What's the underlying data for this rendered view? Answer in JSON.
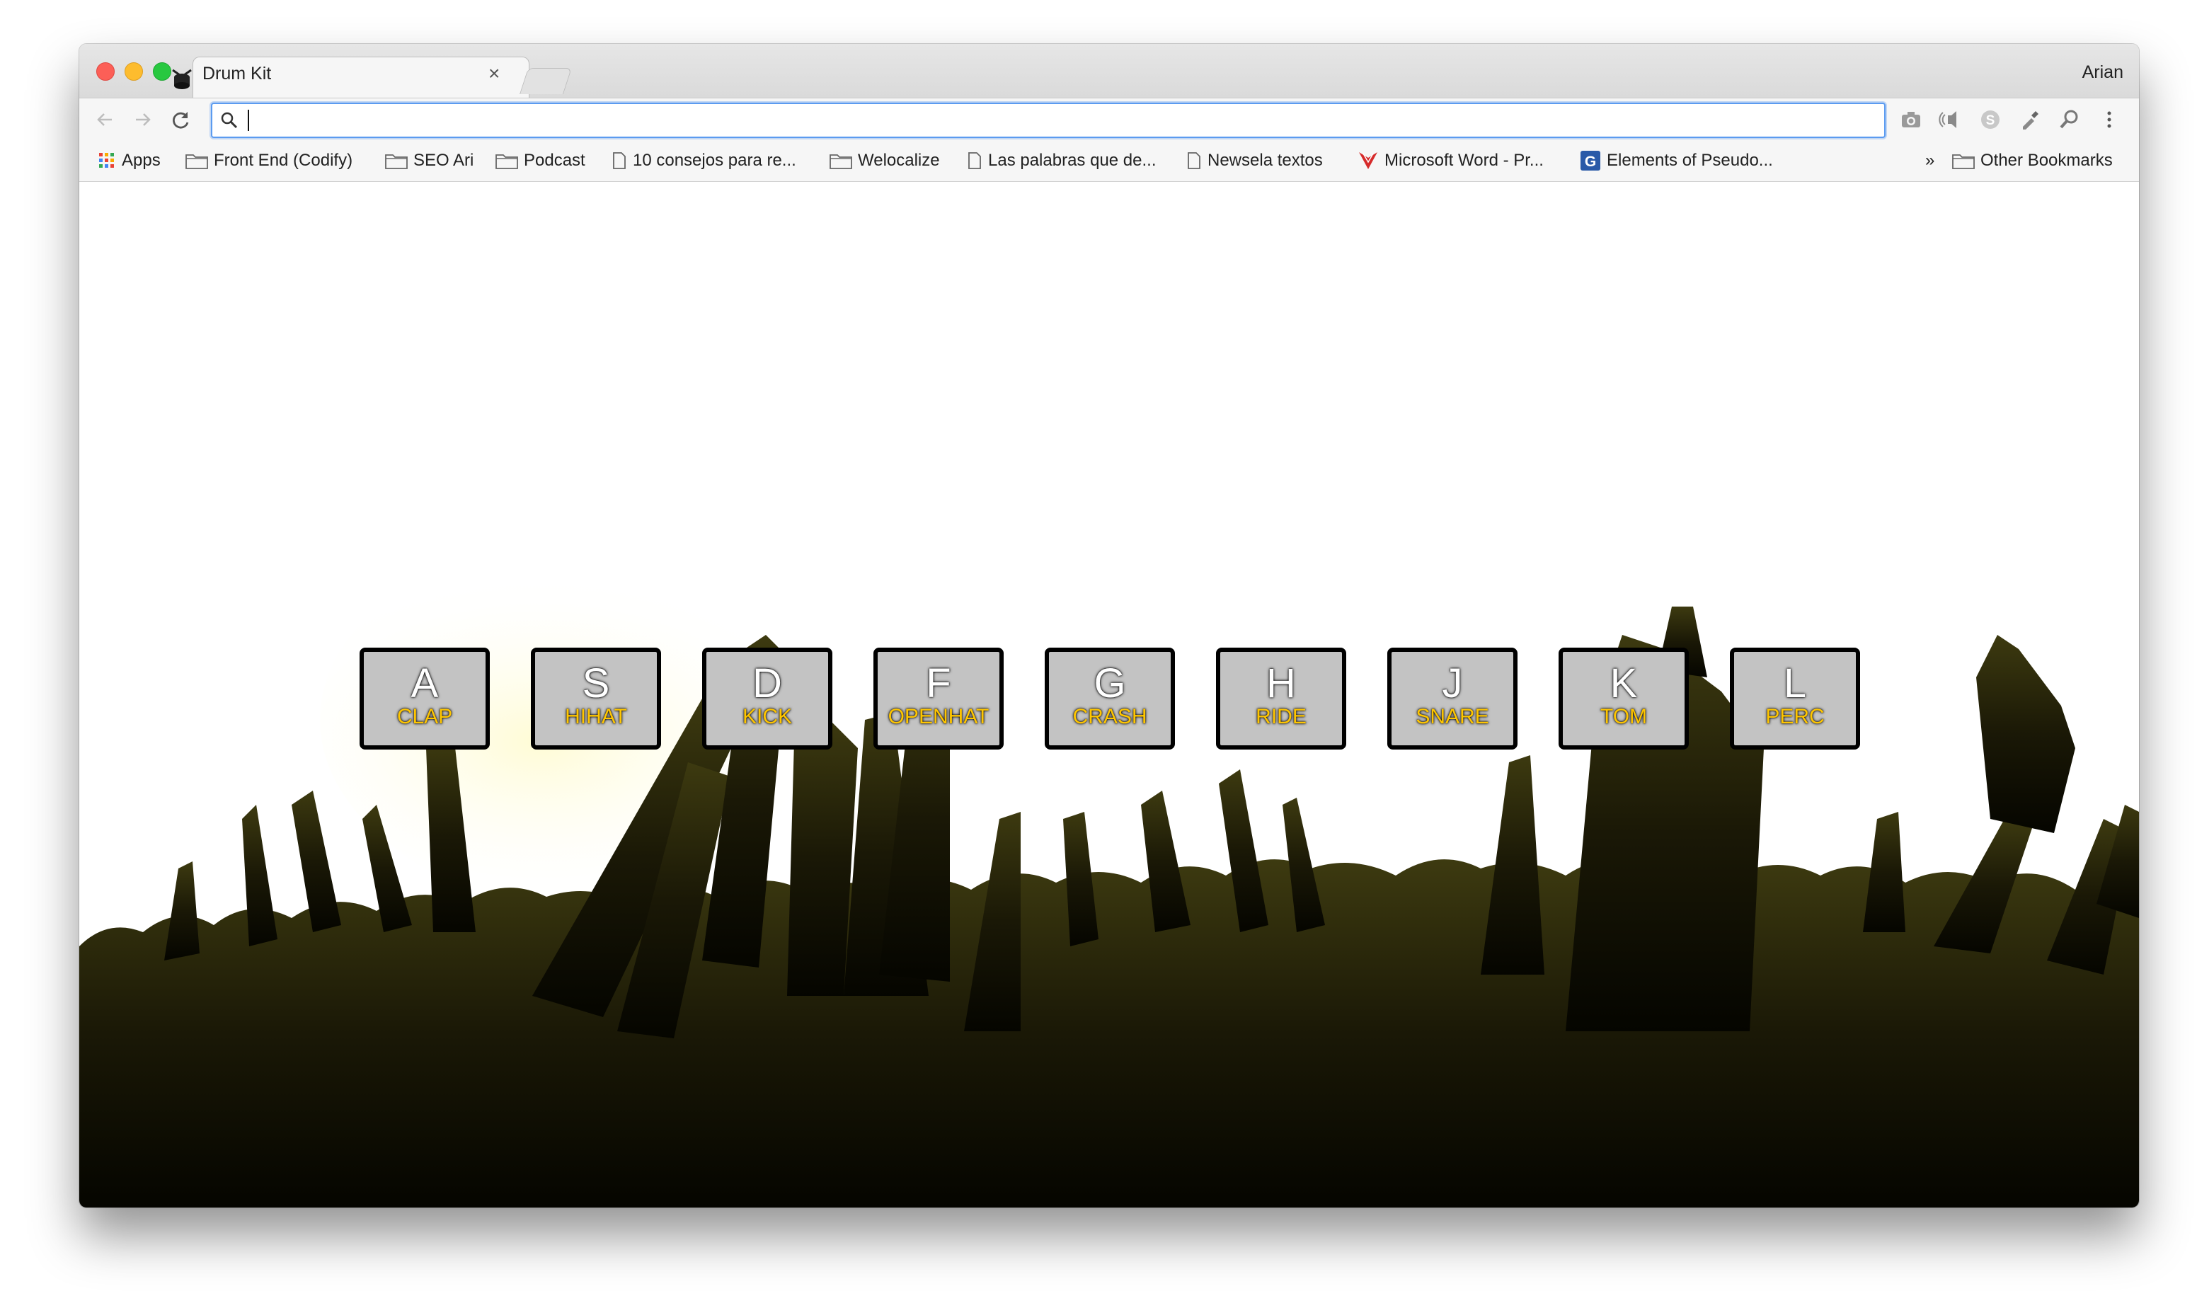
{
  "browser": {
    "tab_title": "Drum Kit",
    "profile_name": "Arian",
    "address_value": "",
    "icons": {
      "tab": "drum-icon",
      "back": "back-arrow-icon",
      "forward": "forward-arrow-icon",
      "reload": "reload-icon",
      "search": "search-icon",
      "extensions": [
        "camera-icon",
        "audio-icon",
        "skype-icon",
        "eyedropper-icon",
        "zoom-icon",
        "more-vertical-icon"
      ]
    }
  },
  "bookmarks": {
    "items": [
      {
        "label": "Apps",
        "icon": "apps-grid-icon"
      },
      {
        "label": "Front End (Codify)",
        "icon": "folder-icon"
      },
      {
        "label": "SEO Ari",
        "icon": "folder-icon"
      },
      {
        "label": "Podcast",
        "icon": "folder-icon"
      },
      {
        "label": "10 consejos para re...",
        "icon": "page-icon"
      },
      {
        "label": "Welocalize",
        "icon": "folder-icon"
      },
      {
        "label": "Las palabras que de...",
        "icon": "page-icon"
      },
      {
        "label": "Newsela textos",
        "icon": "page-icon"
      },
      {
        "label": "Microsoft Word - Pr...",
        "icon": "pdf-icon"
      },
      {
        "label": "Elements of Pseudo...",
        "icon": "g-icon"
      }
    ],
    "overflow_label": "»",
    "other_label": "Other Bookmarks"
  },
  "drum_keys": [
    {
      "letter": "A",
      "sound": "CLAP"
    },
    {
      "letter": "S",
      "sound": "HIHAT"
    },
    {
      "letter": "D",
      "sound": "KICK"
    },
    {
      "letter": "F",
      "sound": "OPENHAT"
    },
    {
      "letter": "G",
      "sound": "CRASH"
    },
    {
      "letter": "H",
      "sound": "RIDE"
    },
    {
      "letter": "J",
      "sound": "SNARE"
    },
    {
      "letter": "K",
      "sound": "TOM"
    },
    {
      "letter": "L",
      "sound": "PERC"
    }
  ],
  "colors": {
    "key_background": "#c3c3c3",
    "key_border": "#000000",
    "key_letter": "#ffffff",
    "key_sound": "#ffc600",
    "omnibox_focus": "#5b9bf0",
    "crowd": "#1a1a08"
  }
}
